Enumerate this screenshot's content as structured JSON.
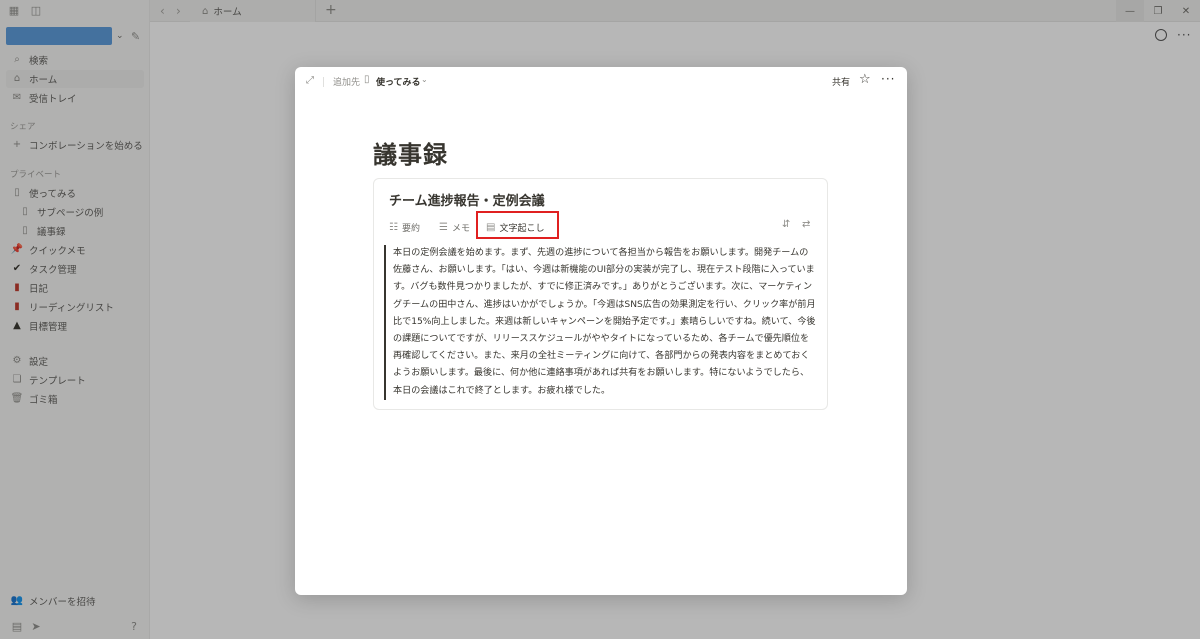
{
  "sidebar": {
    "search_label": "検索",
    "home_label": "ホーム",
    "inbox_label": "受信トレイ",
    "shared_section": "シェア",
    "collab_label": "コンボレーションを始める",
    "private_section": "プライベート",
    "pages": [
      {
        "label": "使ってみる",
        "icon": "page-icon"
      },
      {
        "label": "サブページの例",
        "icon": "page-icon"
      },
      {
        "label": "議事録",
        "icon": "page-icon"
      },
      {
        "label": "クイックメモ",
        "icon": "pin-icon"
      },
      {
        "label": "タスク管理",
        "icon": "check-icon"
      },
      {
        "label": "日記",
        "icon": "journal-icon"
      },
      {
        "label": "リーディングリスト",
        "icon": "book-icon"
      },
      {
        "label": "目標管理",
        "icon": "mountain-icon"
      }
    ],
    "settings_label": "設定",
    "templates_label": "テンプレート",
    "trash_label": "ゴミ箱",
    "invite_label": "メンバーを招待"
  },
  "topbar": {
    "tab_label": "ホーム"
  },
  "modal": {
    "add_to_label": "追加先",
    "page_name": "使ってみる",
    "share_label": "共有"
  },
  "page": {
    "title": "議事録"
  },
  "meeting": {
    "title": "チーム進捗報告・定例会議",
    "tabs": [
      {
        "label": "要約",
        "icon": "summary-icon"
      },
      {
        "label": "メモ",
        "icon": "notes-icon"
      },
      {
        "label": "文字起こし",
        "icon": "transcript-icon",
        "highlighted": true
      }
    ],
    "transcript": "本日の定例会議を始めます。まず、先週の進捗について各担当から報告をお願いします。開発チームの佐藤さん、お願いします。「はい、今週は新機能のUI部分の実装が完了し、現在テスト段階に入っています。バグも数件見つかりましたが、すでに修正済みです。」ありがとうございます。次に、マーケティングチームの田中さん、進捗はいかがでしょうか。「今週はSNS広告の効果測定を行い、クリック率が前月比で15%向上しました。来週は新しいキャンペーンを開始予定です。」素晴らしいですね。続いて、今後の課題についてですが、リリーススケジュールがややタイトになっているため、各チームで優先順位を再確認してください。また、来月の全社ミーティングに向けて、各部門からの発表内容をまとめておくようお願いします。最後に、何か他に連絡事項があれば共有をお願いします。特にないようでしたら、本日の会議はこれで終了とします。お疲れ様でした。"
  },
  "colors": {
    "highlight_border": "#e02020",
    "workspace_block": "#5b9bdc"
  }
}
